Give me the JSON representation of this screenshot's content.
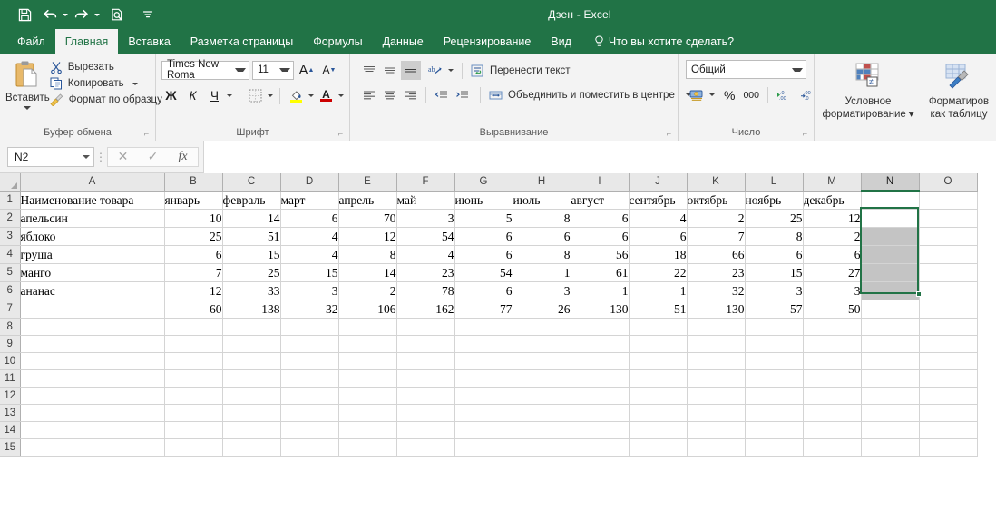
{
  "titlebar": {
    "document_title": "Дзен - Excel",
    "qat": [
      {
        "name": "save-icon",
        "label": "Сохранить"
      },
      {
        "name": "undo-icon",
        "label": "Отменить"
      },
      {
        "name": "redo-icon",
        "label": "Вернуть"
      },
      {
        "name": "print-preview-icon",
        "label": "Предварительный просмотр и печать"
      },
      {
        "name": "customize-qat-icon",
        "label": "Настройка панели быстрого доступа"
      }
    ]
  },
  "tabs": [
    {
      "label": "Файл",
      "active": false
    },
    {
      "label": "Главная",
      "active": true
    },
    {
      "label": "Вставка",
      "active": false
    },
    {
      "label": "Разметка страницы",
      "active": false
    },
    {
      "label": "Формулы",
      "active": false
    },
    {
      "label": "Данные",
      "active": false
    },
    {
      "label": "Рецензирование",
      "active": false
    },
    {
      "label": "Вид",
      "active": false
    }
  ],
  "tell_me": "Что вы хотите сделать?",
  "ribbon": {
    "clipboard": {
      "group_label": "Буфер обмена",
      "paste_label": "Вставить",
      "cut_label": "Вырезать",
      "copy_label": "Копировать",
      "format_painter_label": "Формат по образцу"
    },
    "font": {
      "group_label": "Шрифт",
      "font_name": "Times New Roma",
      "font_size": "11",
      "grow_font": "A",
      "shrink_font": "A",
      "bold": "Ж",
      "italic": "К",
      "underline": "Ч"
    },
    "alignment": {
      "group_label": "Выравнивание",
      "wrap_text": "Перенести текст",
      "merge_center": "Объединить и поместить в центре"
    },
    "number": {
      "group_label": "Число",
      "format": "Общий",
      "percent": "%",
      "thousands": "000"
    },
    "styles": {
      "conditional_formatting": "Условное\nформатирование",
      "conditional_formatting_l1": "Условное",
      "conditional_formatting_l2": "форматирование",
      "format_as_table_l1": "Форматиров",
      "format_as_table_l2": "как таблицу"
    }
  },
  "formula_bar": {
    "name_box": "N2",
    "cancel_icon": "✕",
    "enter_icon": "✓",
    "function_icon": "fx",
    "formula_value": ""
  },
  "grid": {
    "columns": [
      "A",
      "B",
      "C",
      "D",
      "E",
      "F",
      "G",
      "H",
      "I",
      "J",
      "K",
      "L",
      "M",
      "N",
      "O"
    ],
    "selected_column": "N",
    "rows": [
      "1",
      "2",
      "3",
      "4",
      "5",
      "6",
      "7",
      "8",
      "9",
      "10",
      "11",
      "12",
      "13",
      "14",
      "15"
    ],
    "selection_range": "N2:N6",
    "data": [
      [
        "Наименование товара",
        "январь",
        "февраль",
        "март",
        "апрель",
        "май",
        "июнь",
        "июль",
        "август",
        "сентябрь",
        "октябрь",
        "ноябрь",
        "декабрь",
        "",
        ""
      ],
      [
        "апельсин",
        "10",
        "14",
        "6",
        "70",
        "3",
        "5",
        "8",
        "6",
        "4",
        "2",
        "25",
        "12",
        "",
        ""
      ],
      [
        "яблоко",
        "25",
        "51",
        "4",
        "12",
        "54",
        "6",
        "6",
        "6",
        "6",
        "7",
        "8",
        "2",
        "",
        ""
      ],
      [
        "груша",
        "6",
        "15",
        "4",
        "8",
        "4",
        "6",
        "8",
        "56",
        "18",
        "66",
        "6",
        "6",
        "",
        ""
      ],
      [
        "манго",
        "7",
        "25",
        "15",
        "14",
        "23",
        "54",
        "1",
        "61",
        "22",
        "23",
        "15",
        "27",
        "",
        ""
      ],
      [
        "ананас",
        "12",
        "33",
        "3",
        "2",
        "78",
        "6",
        "3",
        "1",
        "1",
        "32",
        "3",
        "3",
        "",
        ""
      ],
      [
        "",
        "60",
        "138",
        "32",
        "106",
        "162",
        "77",
        "26",
        "130",
        "51",
        "130",
        "57",
        "50",
        "",
        ""
      ],
      [
        "",
        "",
        "",
        "",
        "",
        "",
        "",
        "",
        "",
        "",
        "",
        "",
        "",
        "",
        ""
      ],
      [
        "",
        "",
        "",
        "",
        "",
        "",
        "",
        "",
        "",
        "",
        "",
        "",
        "",
        "",
        ""
      ],
      [
        "",
        "",
        "",
        "",
        "",
        "",
        "",
        "",
        "",
        "",
        "",
        "",
        "",
        "",
        ""
      ],
      [
        "",
        "",
        "",
        "",
        "",
        "",
        "",
        "",
        "",
        "",
        "",
        "",
        "",
        "",
        ""
      ],
      [
        "",
        "",
        "",
        "",
        "",
        "",
        "",
        "",
        "",
        "",
        "",
        "",
        "",
        "",
        ""
      ],
      [
        "",
        "",
        "",
        "",
        "",
        "",
        "",
        "",
        "",
        "",
        "",
        "",
        "",
        "",
        ""
      ],
      [
        "",
        "",
        "",
        "",
        "",
        "",
        "",
        "",
        "",
        "",
        "",
        "",
        "",
        "",
        ""
      ],
      [
        "",
        "",
        "",
        "",
        "",
        "",
        "",
        "",
        "",
        "",
        "",
        "",
        "",
        "",
        ""
      ]
    ]
  },
  "colors": {
    "excel_green": "#217346",
    "ribbon_bg": "#f3f3f3",
    "header_bg": "#e8e8e8",
    "selection_fill": "#c4c4c4",
    "grid_line": "#d4d4d4"
  }
}
